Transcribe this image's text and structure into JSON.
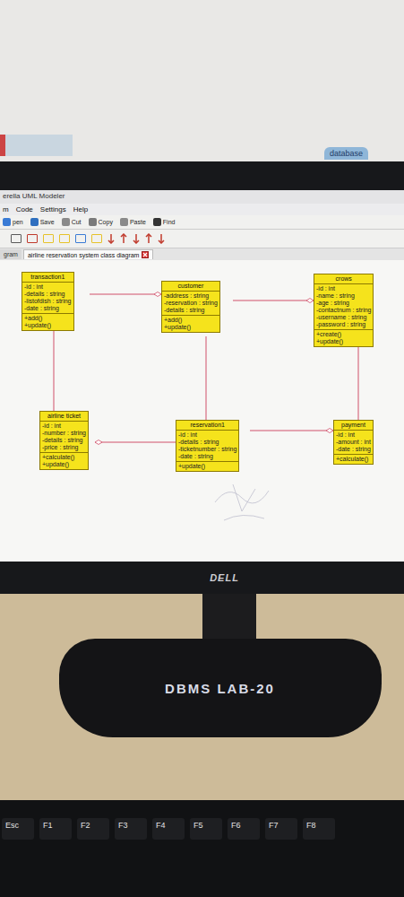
{
  "wall": {
    "sign": "database"
  },
  "window": {
    "title": "erella UML Modeler"
  },
  "menu": [
    "m",
    "Code",
    "Settings",
    "Help"
  ],
  "toolbar": [
    {
      "label": "pen"
    },
    {
      "label": "Save"
    },
    {
      "label": "Cut"
    },
    {
      "label": "Copy"
    },
    {
      "label": "Paste"
    },
    {
      "label": "Find"
    }
  ],
  "tabs": [
    {
      "label": "gram",
      "selected": false
    },
    {
      "label": "airline reservation system class diagram",
      "selected": true
    }
  ],
  "classes": [
    {
      "name": "transaction1",
      "attributes": [
        "-id : int",
        "-details : string",
        "-listofdish : string",
        "-date : string"
      ],
      "operations": [
        "+add()",
        "+update()"
      ]
    },
    {
      "name": "customer",
      "attributes": [
        "-address : string",
        "-reservation : string",
        "-details : string"
      ],
      "operations": [
        "+add()",
        "+update()"
      ]
    },
    {
      "name": "crows",
      "attributes": [
        "-id : int",
        "-name : string",
        "-age : string",
        "-contactnum : string",
        "-username : string",
        "-password : string"
      ],
      "operations": [
        "+create()",
        "+update()"
      ]
    },
    {
      "name": "airline ticket",
      "attributes": [
        "-id : int",
        "-number : string",
        "-details : string",
        "-price : string"
      ],
      "operations": [
        "+calculate()",
        "+update()"
      ]
    },
    {
      "name": "reservation1",
      "attributes": [
        "-id : int",
        "-details : string",
        "-ticketnumber : string",
        "-date : string"
      ],
      "operations": [
        "+update()"
      ]
    },
    {
      "name": "payment",
      "attributes": [
        "-id : int",
        "-amount : int",
        "-date : string"
      ],
      "operations": [
        "+calculate()"
      ]
    }
  ],
  "relations": [
    {
      "from": "transaction1",
      "to": "customer",
      "aggregate": "customer"
    },
    {
      "from": "customer",
      "to": "crows",
      "aggregate": "crows"
    },
    {
      "from": "transaction1",
      "to": "airline ticket",
      "aggregate": null
    },
    {
      "from": "customer",
      "to": "reservation1",
      "aggregate": null
    },
    {
      "from": "crows",
      "to": "payment",
      "aggregate": null
    },
    {
      "from": "airline ticket",
      "to": "reservation1",
      "aggregate": "airline ticket"
    },
    {
      "from": "reservation1",
      "to": "payment",
      "aggregate": "payment"
    }
  ],
  "monitor": {
    "logo": "DELL"
  },
  "stand": {
    "sticker": "DBMS LAB-20"
  },
  "keys": [
    "Esc",
    "F1",
    "F2",
    "F3",
    "F4",
    "F5",
    "F6",
    "F7",
    "F8"
  ]
}
